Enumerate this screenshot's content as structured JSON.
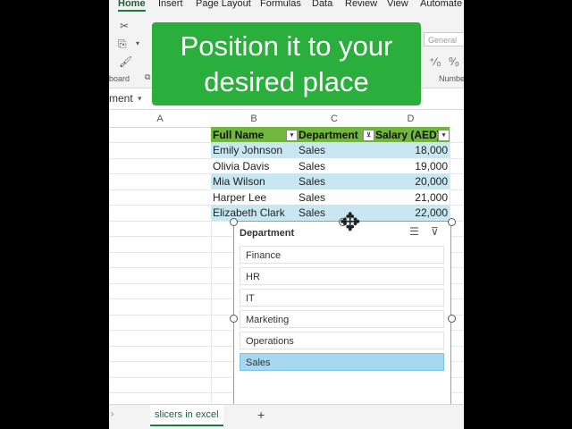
{
  "ribbon": {
    "tabs": [
      "Home",
      "Insert",
      "Page Layout",
      "Formulas",
      "Data",
      "Review",
      "View",
      "Automate"
    ],
    "group_labels": {
      "clipboard": "board",
      "number": "Numbe"
    },
    "number_format": "General"
  },
  "formula_bar": {
    "name_box": "ment"
  },
  "columns": [
    "A",
    "B",
    "C",
    "D"
  ],
  "table": {
    "headers": [
      "Full Name",
      "Department",
      "Salary (AED)"
    ],
    "rows": [
      [
        "Emily Johnson",
        "Sales",
        "18,000"
      ],
      [
        "Olivia Davis",
        "Sales",
        "19,000"
      ],
      [
        "Mia Wilson",
        "Sales",
        "20,000"
      ],
      [
        "Harper Lee",
        "Sales",
        "21,000"
      ],
      [
        "Elizabeth Clark",
        "Sales",
        "22,000"
      ]
    ]
  },
  "slicer": {
    "title": "Department",
    "items": [
      "Finance",
      "HR",
      "IT",
      "Marketing",
      "Operations",
      "Sales"
    ],
    "selected": "Sales"
  },
  "overlay": {
    "line1": "Position it to your",
    "line2": "desired place"
  },
  "sheets": {
    "active": "slicers in excel"
  },
  "colors": {
    "header_green": "#70b63f",
    "band_blue": "#c8e7f3",
    "banner_green": "#2aae3c",
    "slicer_selected": "#a6d8ef"
  }
}
